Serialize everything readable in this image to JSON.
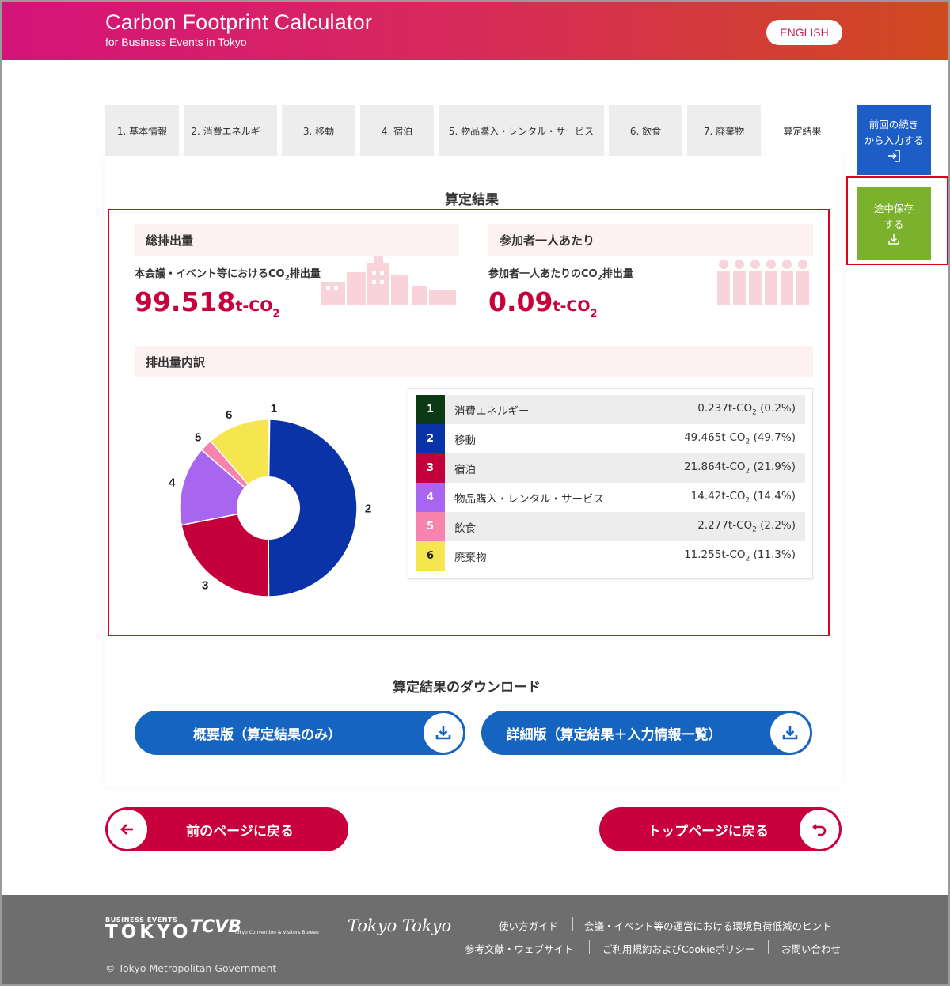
{
  "header": {
    "title": "Carbon Footprint Calculator",
    "subtitle": "for Business Events in Tokyo",
    "lang_button": "ENGLISH"
  },
  "tabs": [
    {
      "label": "1. 基本情報"
    },
    {
      "label": "2. 消費エネルギー"
    },
    {
      "label": "3. 移動"
    },
    {
      "label": "4. 宿泊"
    },
    {
      "label": "5. 物品購入・レンタル・サービス"
    },
    {
      "label": "6. 飲食"
    },
    {
      "label": "7. 廃棄物"
    },
    {
      "label": "算定結果"
    }
  ],
  "side": {
    "resume_line1": "前回の続き",
    "resume_line2": "から入力する",
    "save_line1": "途中保存",
    "save_line2": "する"
  },
  "result": {
    "title": "算定結果",
    "total": {
      "label": "総排出量",
      "desc_prefix": "本会議・イベント等における",
      "desc_co": "CO",
      "desc_sub": "2",
      "desc_suffix": "排出量",
      "value": "99.518",
      "unit": "t-CO",
      "unit_sub": "2"
    },
    "per_person": {
      "label": "参加者一人あたり",
      "desc_prefix": "参加者一人あたりの",
      "desc_co": "CO",
      "desc_sub": "2",
      "desc_suffix": "排出量",
      "value": "0.09",
      "unit": "t-CO",
      "unit_sub": "2"
    },
    "breakdown_label": "排出量内訳"
  },
  "chart_data": {
    "type": "pie",
    "categories": [
      "消費エネルギー",
      "移動",
      "宿泊",
      "物品購入・レンタル・サービス",
      "飲食",
      "廃棄物"
    ],
    "slice_labels": [
      "1",
      "2",
      "3",
      "4",
      "5",
      "6"
    ],
    "values": [
      0.237,
      49.465,
      21.864,
      14.42,
      2.277,
      11.255
    ],
    "percent": [
      0.2,
      49.7,
      21.9,
      14.4,
      2.2,
      11.3
    ],
    "colors": [
      "#0b3a14",
      "#0b33a8",
      "#c4003a",
      "#a866f0",
      "#f784ac",
      "#f5e650"
    ],
    "donut": true
  },
  "legend_rows": [
    {
      "num": "1",
      "name": "消費エネルギー",
      "val": "0.237t-CO",
      "sub": "2",
      "pct": " (0.2%)",
      "color": "#0b3a14"
    },
    {
      "num": "2",
      "name": "移動",
      "val": "49.465t-CO",
      "sub": "2",
      "pct": " (49.7%)",
      "color": "#0b33a8"
    },
    {
      "num": "3",
      "name": "宿泊",
      "val": "21.864t-CO",
      "sub": "2",
      "pct": " (21.9%)",
      "color": "#c4003a"
    },
    {
      "num": "4",
      "name": "物品購入・レンタル・サービス",
      "val": "14.42t-CO",
      "sub": "2",
      "pct": " (14.4%)",
      "color": "#a866f0"
    },
    {
      "num": "5",
      "name": "飲食",
      "val": "2.277t-CO",
      "sub": "2",
      "pct": " (2.2%)",
      "color": "#f784ac"
    },
    {
      "num": "6",
      "name": "廃棄物",
      "val": "11.255t-CO",
      "sub": "2",
      "pct": " (11.3%)",
      "color": "#f5e650"
    }
  ],
  "download": {
    "title": "算定結果のダウンロード",
    "summary_button": "概要版（算定結果のみ）",
    "detail_button": "詳細版（算定結果＋入力情報一覧）"
  },
  "nav": {
    "back_button": "前のページに戻る",
    "top_button": "トップページに戻る"
  },
  "footer": {
    "logo_business_events": "BUSINESS EVENTS",
    "logo_tokyo": "TOKYO",
    "logo_tcvb": "TCVB",
    "logo_tcvb_sub": "Tokyo Convention & Visitors Bureau",
    "logo_tokyotokyo": "Tokyo Tokyo",
    "links_row1": [
      "使い方ガイド",
      "会議・イベント等の運営における環境負荷低減のヒント"
    ],
    "links_row2": [
      "参考文献・ウェブサイト",
      "ご利用規約およびCookieポリシー",
      "お問い合わせ"
    ],
    "copyright": "© Tokyo Metropolitan Government"
  }
}
